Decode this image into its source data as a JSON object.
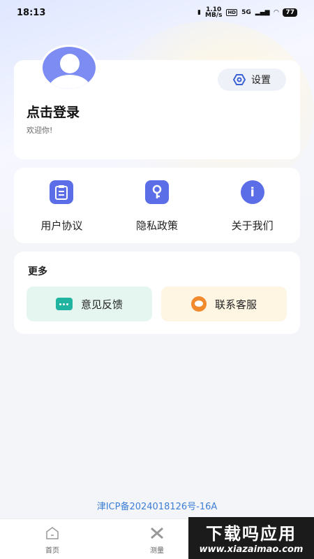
{
  "status_bar": {
    "time": "18:13",
    "network_speed": "1.10",
    "network_unit": "MB/s",
    "hd_badge": "HD",
    "signal_label": "5G",
    "battery": "77"
  },
  "profile": {
    "login_text": "点击登录",
    "welcome_text": "欢迎你!",
    "settings_label": "设置",
    "avatar_icon": "user-avatar-icon"
  },
  "links": [
    {
      "label": "用户协议",
      "icon": "clipboard-icon"
    },
    {
      "label": "隐私政策",
      "icon": "key-icon"
    },
    {
      "label": "关于我们",
      "icon": "info-icon"
    }
  ],
  "more": {
    "title": "更多",
    "feedback_label": "意见反馈",
    "service_label": "联系客服"
  },
  "footer": {
    "icp": "津ICP备2024018126号-16A"
  },
  "tabbar": {
    "tabs": [
      {
        "label": "首页",
        "icon": "home-icon"
      },
      {
        "label": "测量",
        "icon": "ruler-icon"
      }
    ]
  },
  "watermark": {
    "main": "下载吗应用",
    "sub": "www.xiazaimao.com"
  },
  "colors": {
    "accent": "#5b6ee8",
    "feedback_bg": "#e5f6f1",
    "service_bg": "#fff5e3",
    "icp": "#3d7fd6"
  }
}
